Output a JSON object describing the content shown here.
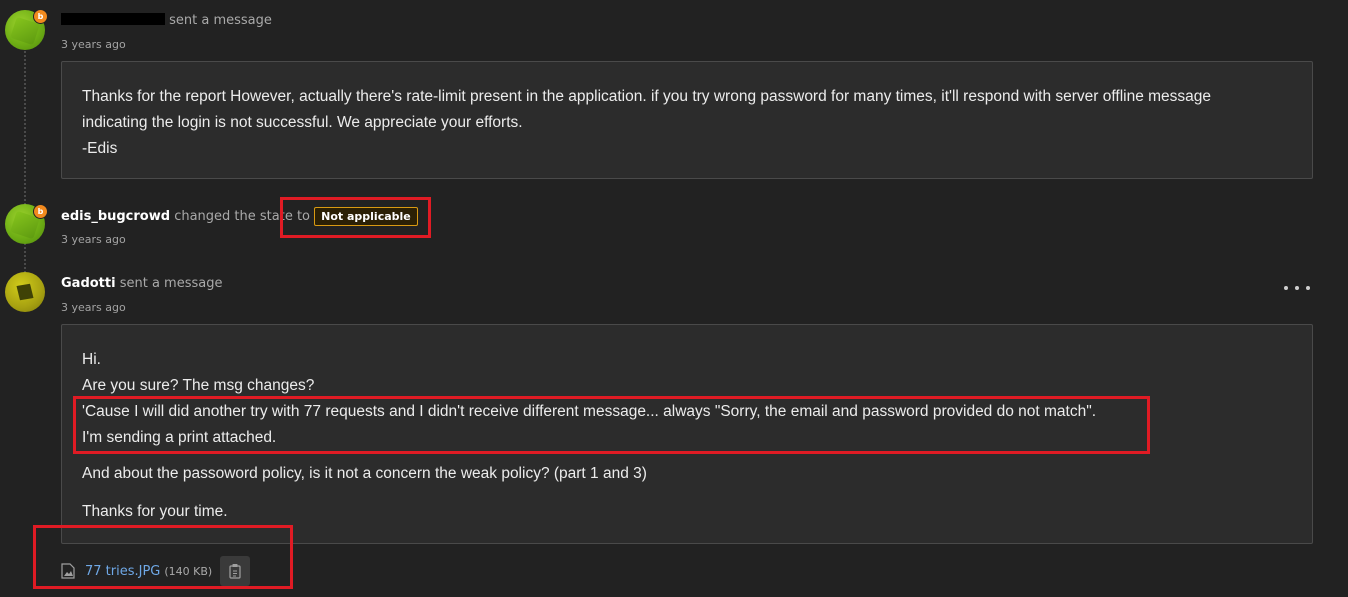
{
  "events": [
    {
      "author_redacted": true,
      "action": "sent a message",
      "time": "3 years ago",
      "message_lines": [
        "Thanks for the report However, actually there's rate-limit present in the application. if you try wrong password for many times, it'll respond with server offline message",
        "indicating the login is not successful. We appreciate your efforts.",
        "-Edis"
      ]
    },
    {
      "author": "edis_bugcrowd",
      "action": "changed the state to",
      "state": "Not applicable",
      "time": "3 years ago"
    },
    {
      "author": "Gadotti",
      "action": "sent a message",
      "time": "3 years ago",
      "message_lines": [
        "Hi.",
        "Are you sure? The msg changes?",
        "'Cause I will did another try with 77 requests and I didn't receive different message... always \"Sorry, the email and password provided do not match\".",
        "I'm sending a print attached.",
        "And about the passoword policy, is it not a concern the weak policy? (part 1 and 3)",
        "Thanks for your time."
      ],
      "attachment": {
        "name": "77 tries.JPG",
        "size": "(140 KB)"
      }
    }
  ],
  "badge_letter": "b",
  "icons": [
    "more-options-icon",
    "file-image-icon",
    "clipboard-copy-icon"
  ],
  "colors": {
    "highlight": "#e01b24",
    "state_border": "#d99a12",
    "link": "#6fa8e6"
  }
}
